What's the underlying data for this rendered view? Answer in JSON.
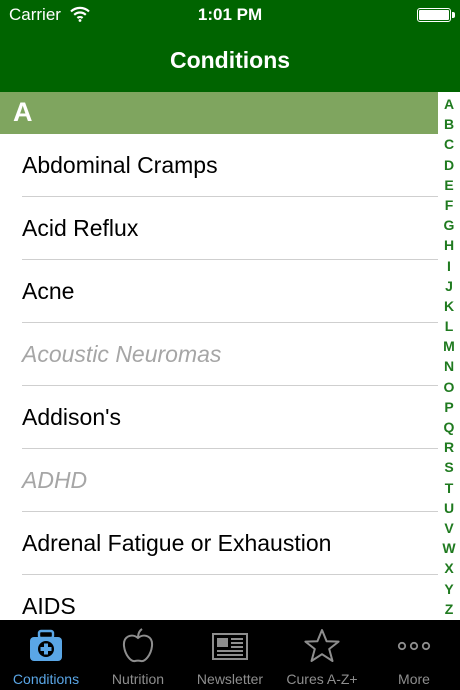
{
  "status_bar": {
    "carrier": "Carrier",
    "time": "1:01 PM"
  },
  "nav": {
    "title": "Conditions"
  },
  "section": {
    "letter": "A"
  },
  "conditions": [
    {
      "label": "Abdominal Cramps",
      "available": true
    },
    {
      "label": "Acid Reflux",
      "available": true
    },
    {
      "label": "Acne",
      "available": true
    },
    {
      "label": "Acoustic Neuromas",
      "available": false
    },
    {
      "label": "Addison's",
      "available": true
    },
    {
      "label": "ADHD",
      "available": false
    },
    {
      "label": "Adrenal Fatigue or Exhaustion",
      "available": true
    },
    {
      "label": "AIDS",
      "available": true
    }
  ],
  "index_letters": [
    "A",
    "B",
    "C",
    "D",
    "E",
    "F",
    "G",
    "H",
    "I",
    "J",
    "K",
    "L",
    "M",
    "N",
    "O",
    "P",
    "Q",
    "R",
    "S",
    "T",
    "U",
    "V",
    "W",
    "X",
    "Y",
    "Z"
  ],
  "tabs": [
    {
      "label": "Conditions",
      "icon": "medical-kit-icon",
      "active": true
    },
    {
      "label": "Nutrition",
      "icon": "apple-icon",
      "active": false
    },
    {
      "label": "Newsletter",
      "icon": "newspaper-icon",
      "active": false
    },
    {
      "label": "Cures A-Z+",
      "icon": "star-icon",
      "active": false
    },
    {
      "label": "More",
      "icon": "more-dots-icon",
      "active": false
    }
  ],
  "colors": {
    "nav_green": "#006400",
    "section_green": "#7fa55f",
    "index_green": "#1f7a1f",
    "active_tab_blue": "#5aa6e6",
    "inactive_tab_gray": "#8e8e8e"
  }
}
